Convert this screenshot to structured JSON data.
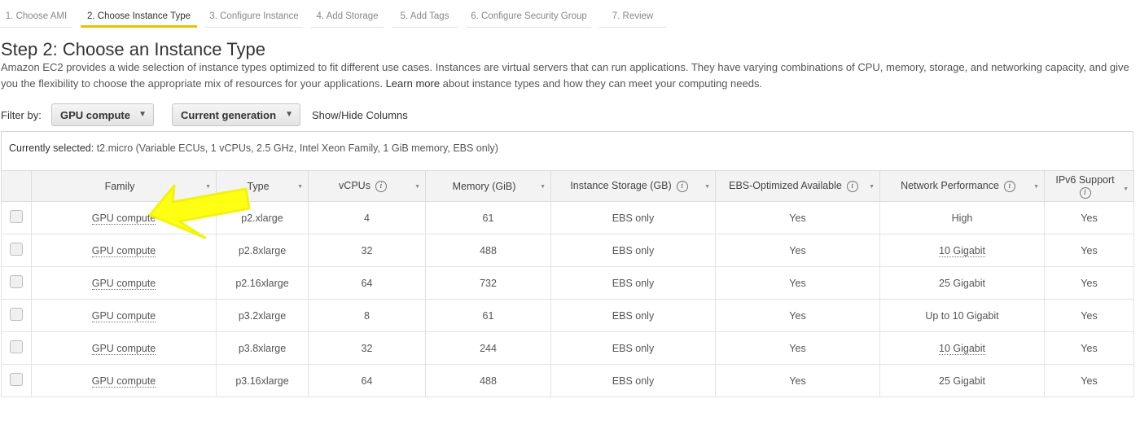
{
  "steps": [
    {
      "label": "1. Choose AMI",
      "active": false
    },
    {
      "label": "2. Choose Instance Type",
      "active": true
    },
    {
      "label": "3. Configure Instance",
      "active": false
    },
    {
      "label": "4. Add Storage",
      "active": false
    },
    {
      "label": "5. Add Tags",
      "active": false
    },
    {
      "label": "6. Configure Security Group",
      "active": false
    },
    {
      "label": "7. Review",
      "active": false
    }
  ],
  "page": {
    "title": "Step 2: Choose an Instance Type",
    "desc_part1": "Amazon EC2 provides a wide selection of instance types optimized to fit different use cases. Instances are virtual servers that can run applications. They have varying combinations of CPU, memory, storage, and networking capacity, and give you the flexibility to choose the appropriate mix of resources for your applications. ",
    "learn_more": "Learn more",
    "desc_part2": " about instance types and how they can meet your computing needs."
  },
  "filter": {
    "label": "Filter by:",
    "family_value": "GPU compute",
    "generation_value": "Current generation",
    "show_hide": "Show/Hide Columns"
  },
  "selection": {
    "label": "Currently selected:",
    "value": " t2.micro (Variable ECUs, 1 vCPUs, 2.5 GHz, Intel Xeon Family, 1 GiB memory, EBS only)"
  },
  "table": {
    "headers": {
      "family": "Family",
      "type": "Type",
      "vcpus": "vCPUs",
      "memory": "Memory (GiB)",
      "storage": "Instance Storage (GB)",
      "ebs": "EBS-Optimized Available",
      "network": "Network Performance",
      "ipv6": "IPv6 Support"
    },
    "rows": [
      {
        "family": "GPU compute",
        "type": "p2.xlarge",
        "vcpus": "4",
        "memory": "61",
        "storage": "EBS only",
        "ebs": "Yes",
        "network": "High",
        "ipv6": "Yes"
      },
      {
        "family": "GPU compute",
        "type": "p2.8xlarge",
        "vcpus": "32",
        "memory": "488",
        "storage": "EBS only",
        "ebs": "Yes",
        "network": "10 Gigabit",
        "ipv6": "Yes"
      },
      {
        "family": "GPU compute",
        "type": "p2.16xlarge",
        "vcpus": "64",
        "memory": "732",
        "storage": "EBS only",
        "ebs": "Yes",
        "network": "25 Gigabit",
        "ipv6": "Yes"
      },
      {
        "family": "GPU compute",
        "type": "p3.2xlarge",
        "vcpus": "8",
        "memory": "61",
        "storage": "EBS only",
        "ebs": "Yes",
        "network": "Up to 10 Gigabit",
        "ipv6": "Yes"
      },
      {
        "family": "GPU compute",
        "type": "p3.8xlarge",
        "vcpus": "32",
        "memory": "244",
        "storage": "EBS only",
        "ebs": "Yes",
        "network": "10 Gigabit",
        "ipv6": "Yes"
      },
      {
        "family": "GPU compute",
        "type": "p3.16xlarge",
        "vcpus": "64",
        "memory": "488",
        "storage": "EBS only",
        "ebs": "Yes",
        "network": "25 Gigabit",
        "ipv6": "Yes"
      }
    ]
  },
  "colors": {
    "active_step_underline": "#e8c200",
    "highlight_arrow": "#ffff00"
  },
  "icons": {
    "info": "info-icon",
    "sort": "sort-caret-icon",
    "dropdown": "chevron-down-icon",
    "annotation": "yellow-arrow-annotation"
  }
}
